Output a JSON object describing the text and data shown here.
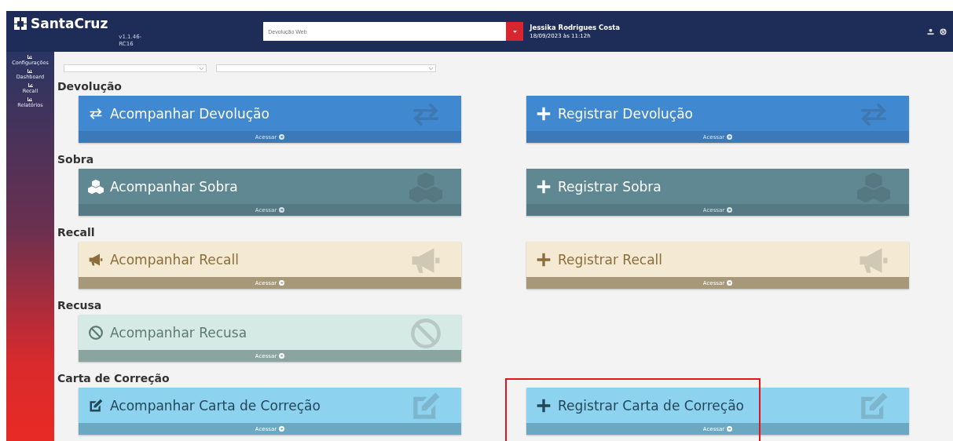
{
  "header": {
    "brand": "SantaCruz",
    "version": "v1.1.46-RC16",
    "search": {
      "placeholder": "Devolução Web"
    },
    "user": {
      "name": "Jessika Rodrigues Costa",
      "datetime": "18/09/2023 às 11:12h"
    }
  },
  "sidebar": {
    "items": [
      {
        "label": "Configurações",
        "selected": false
      },
      {
        "label": "Dashboard",
        "selected": false
      },
      {
        "label": "Recall",
        "selected": false
      },
      {
        "label": "Relatórios",
        "selected": false
      }
    ]
  },
  "filters": [
    {
      "kind": "select"
    },
    {
      "kind": "select"
    }
  ],
  "sections": [
    {
      "title": "Devolução",
      "cards": [
        {
          "kind": "track",
          "label": "Acompanhar Devolução",
          "footer": "Acessar",
          "highlighted": false
        },
        {
          "kind": "register",
          "label": "Registrar Devolução",
          "footer": "Acessar",
          "highlighted": false
        }
      ]
    },
    {
      "title": "Sobra",
      "cards": [
        {
          "kind": "track",
          "label": "Acompanhar Sobra",
          "footer": "Acessar",
          "highlighted": false
        },
        {
          "kind": "register",
          "label": "Registrar Sobra",
          "footer": "Acessar",
          "highlighted": false
        }
      ]
    },
    {
      "title": "Recall",
      "cards": [
        {
          "kind": "track",
          "label": "Acompanhar Recall",
          "footer": "Acessar",
          "highlighted": false
        },
        {
          "kind": "register",
          "label": "Registrar Recall",
          "footer": "Acessar",
          "highlighted": false
        }
      ]
    },
    {
      "title": "Recusa",
      "cards": [
        {
          "kind": "track",
          "label": "Acompanhar Recusa",
          "footer": "Acessar",
          "highlighted": false
        }
      ]
    },
    {
      "title": "Carta de Correção",
      "cards": [
        {
          "kind": "track",
          "label": "Acompanhar Carta de Correção",
          "footer": "Acessar",
          "highlighted": false
        },
        {
          "kind": "register",
          "label": "Registrar Carta de Correção",
          "footer": "Acessar",
          "highlighted": true
        }
      ]
    }
  ]
}
